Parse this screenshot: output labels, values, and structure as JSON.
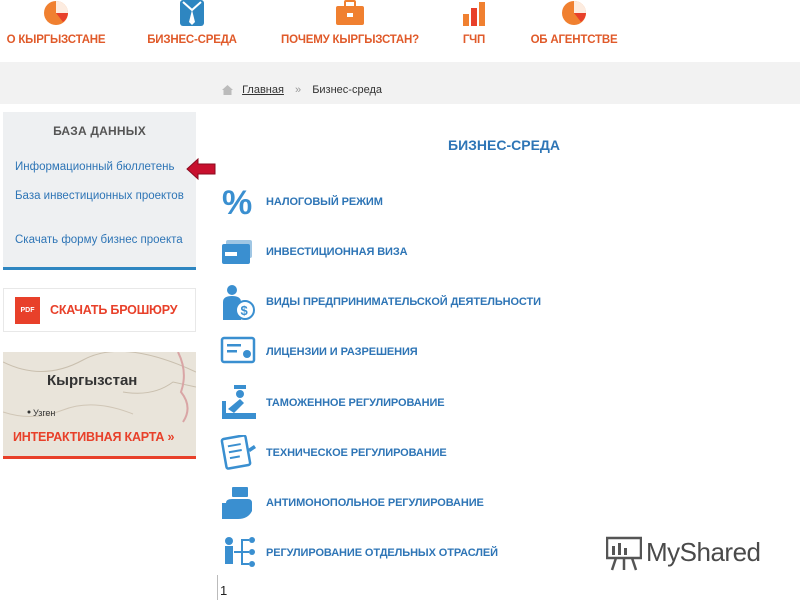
{
  "topnav": [
    {
      "label": "О КЫРГЫЗСТАНЕ",
      "icon": "pie-chart-icon"
    },
    {
      "label": "БИЗНЕС-СРЕДА",
      "icon": "shirt-tie-icon"
    },
    {
      "label": "ПОЧЕМУ КЫРГЫЗСТАН?",
      "icon": "briefcase-icon"
    },
    {
      "label": "ГЧП",
      "icon": "bar-chart-icon"
    },
    {
      "label": "ОБ АГЕНТСТВЕ",
      "icon": "pie-chart-icon"
    }
  ],
  "breadcrumb": {
    "home": "Главная",
    "current": "Бизнес-среда"
  },
  "sidebar": {
    "title": "БАЗА ДАННЫХ",
    "links": [
      "Информационный бюллетень",
      "База инвестиционных проектов",
      "Скачать форму бизнес проекта"
    ]
  },
  "brochure": {
    "badge": "PDF",
    "label": "СКАЧАТЬ БРОШЮРУ"
  },
  "map": {
    "country": "Кыргызстан",
    "city": "Узген",
    "label": "ИНТЕРАКТИВНАЯ КАРТА »"
  },
  "main": {
    "title": "БИЗНЕС-СРЕДА",
    "items": [
      {
        "label": "НАЛОГОВЫЙ РЕЖИМ",
        "icon": "percent-icon"
      },
      {
        "label": "ИНВЕСТИЦИОННАЯ ВИЗА",
        "icon": "card-icon"
      },
      {
        "label": "ВИДЫ ПРЕДПРИНИМАТЕЛЬСКОЙ ДЕЯТЕЛЬНОСТИ",
        "icon": "businessman-dollar-icon"
      },
      {
        "label": "ЛИЦЕНЗИИ И РАЗРЕШЕНИЯ",
        "icon": "certificate-icon"
      },
      {
        "label": "ТАМОЖЕННОЕ РЕГУЛИРОВАНИЕ",
        "icon": "customs-officer-icon"
      },
      {
        "label": "ТЕХНИЧЕСКОЕ РЕГУЛИРОВАНИЕ",
        "icon": "document-pencil-icon"
      },
      {
        "label": "АНТИМОНОПОЛЬНОЕ РЕГУЛИРОВАНИЕ",
        "icon": "hand-money-icon"
      },
      {
        "label": "РЕГУЛИРОВАНИЕ ОТДЕЛЬНЫХ ОТРАСЛЕЙ",
        "icon": "org-chart-icon"
      }
    ]
  },
  "page_number": "1",
  "watermark": "MyShared",
  "colors": {
    "accent_orange": "#e05a2a",
    "link_blue": "#2e75b6",
    "icon_blue": "#3a8fd0",
    "arrow_red": "#c8102e"
  }
}
